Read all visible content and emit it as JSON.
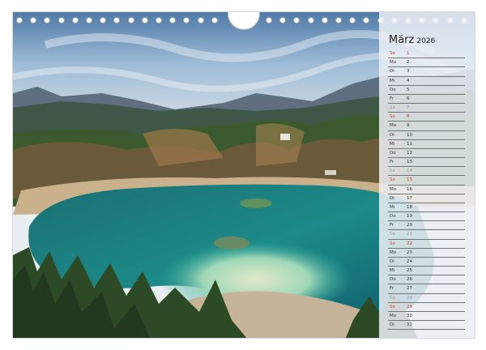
{
  "calendar": {
    "month": "März",
    "year": "2026",
    "days": [
      {
        "day": "So",
        "date": "1",
        "type": "sun"
      },
      {
        "day": "Mo",
        "date": "2",
        "type": "week"
      },
      {
        "day": "Di",
        "date": "3",
        "type": "week"
      },
      {
        "day": "Mi",
        "date": "4",
        "type": "week"
      },
      {
        "day": "Do",
        "date": "5",
        "type": "week"
      },
      {
        "day": "Fr",
        "date": "6",
        "type": "week"
      },
      {
        "day": "Sa",
        "date": "7",
        "type": "sat"
      },
      {
        "day": "So",
        "date": "8",
        "type": "sun"
      },
      {
        "day": "Mo",
        "date": "9",
        "type": "week"
      },
      {
        "day": "Di",
        "date": "10",
        "type": "week"
      },
      {
        "day": "Mi",
        "date": "11",
        "type": "week"
      },
      {
        "day": "Do",
        "date": "12",
        "type": "week"
      },
      {
        "day": "Fr",
        "date": "13",
        "type": "week"
      },
      {
        "day": "Sa",
        "date": "14",
        "type": "sat"
      },
      {
        "day": "So",
        "date": "15",
        "type": "sun"
      },
      {
        "day": "Mo",
        "date": "16",
        "type": "week"
      },
      {
        "day": "Di",
        "date": "17",
        "type": "week"
      },
      {
        "day": "Mi",
        "date": "18",
        "type": "week"
      },
      {
        "day": "Do",
        "date": "19",
        "type": "week"
      },
      {
        "day": "Fr",
        "date": "20",
        "type": "week"
      },
      {
        "day": "Sa",
        "date": "21",
        "type": "sat"
      },
      {
        "day": "So",
        "date": "22",
        "type": "sun"
      },
      {
        "day": "Mo",
        "date": "23",
        "type": "week"
      },
      {
        "day": "Di",
        "date": "24",
        "type": "week"
      },
      {
        "day": "Mi",
        "date": "25",
        "type": "week"
      },
      {
        "day": "Do",
        "date": "26",
        "type": "week"
      },
      {
        "day": "Fr",
        "date": "27",
        "type": "week"
      },
      {
        "day": "Sa",
        "date": "28",
        "type": "sat"
      },
      {
        "day": "So",
        "date": "29",
        "type": "sun"
      },
      {
        "day": "Mo",
        "date": "30",
        "type": "week"
      },
      {
        "day": "Di",
        "date": "31",
        "type": "week"
      }
    ]
  },
  "colors": {
    "sunday": "#d23b3b",
    "saturday": "#9aa0a4",
    "lake_turquoise": "#1f8f86",
    "sky": "#8fb3d4"
  }
}
